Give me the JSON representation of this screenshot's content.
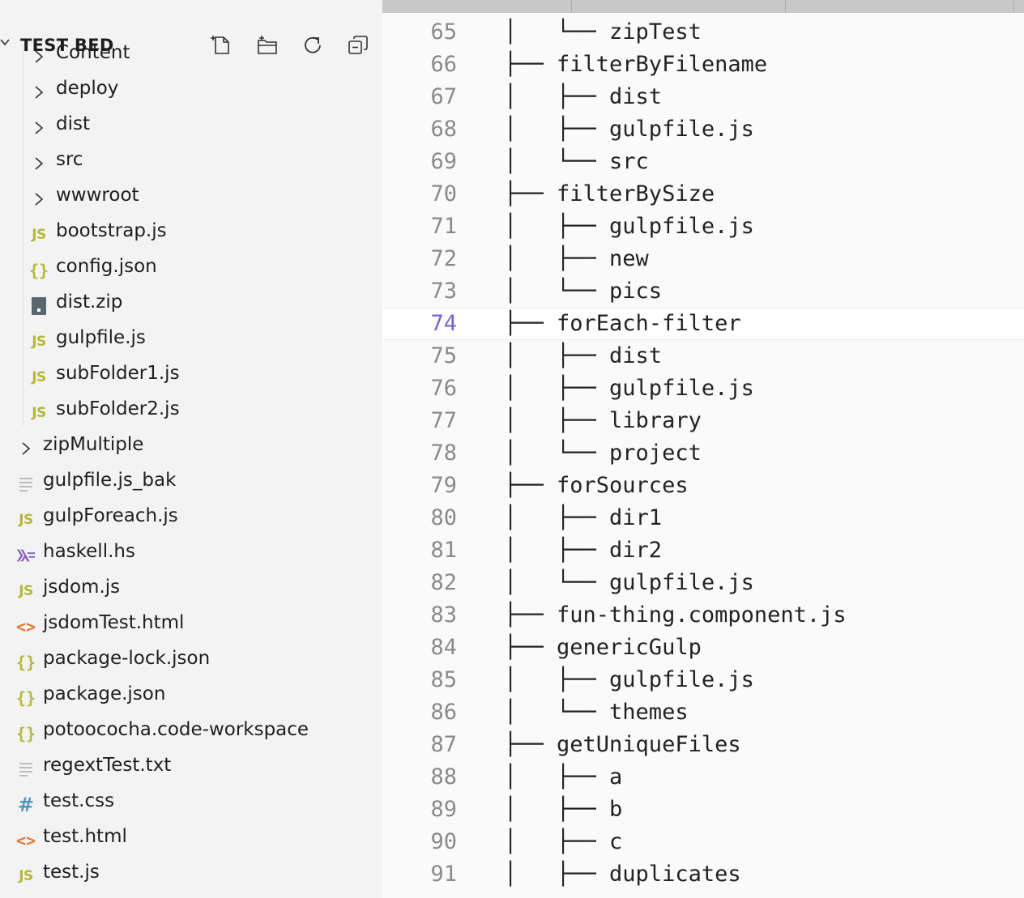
{
  "explorer": {
    "title": "TEST BED",
    "actions": [
      {
        "name": "new-file-icon"
      },
      {
        "name": "new-folder-icon"
      },
      {
        "name": "refresh-icon"
      },
      {
        "name": "collapse-all-icon"
      }
    ],
    "items": [
      {
        "label": "Content",
        "type": "folder",
        "depth": 2
      },
      {
        "label": "deploy",
        "type": "folder",
        "depth": 2
      },
      {
        "label": "dist",
        "type": "folder",
        "depth": 2
      },
      {
        "label": "src",
        "type": "folder",
        "depth": 2
      },
      {
        "label": "wwwroot",
        "type": "folder",
        "depth": 2
      },
      {
        "label": "bootstrap.js",
        "type": "js",
        "depth": 2
      },
      {
        "label": "config.json",
        "type": "json",
        "depth": 2
      },
      {
        "label": "dist.zip",
        "type": "zip",
        "depth": 2
      },
      {
        "label": "gulpfile.js",
        "type": "js",
        "depth": 2
      },
      {
        "label": "subFolder1.js",
        "type": "js",
        "depth": 2
      },
      {
        "label": "subFolder2.js",
        "type": "js",
        "depth": 2
      },
      {
        "label": "zipMultiple",
        "type": "folder",
        "depth": 1
      },
      {
        "label": "gulpfile.js_bak",
        "type": "text",
        "depth": 1
      },
      {
        "label": "gulpForeach.js",
        "type": "js",
        "depth": 1
      },
      {
        "label": "haskell.hs",
        "type": "haskell",
        "depth": 1
      },
      {
        "label": "jsdom.js",
        "type": "js",
        "depth": 1
      },
      {
        "label": "jsdomTest.html",
        "type": "html",
        "depth": 1
      },
      {
        "label": "package-lock.json",
        "type": "json",
        "depth": 1
      },
      {
        "label": "package.json",
        "type": "json",
        "depth": 1
      },
      {
        "label": "potoococha.code-workspace",
        "type": "json",
        "depth": 1
      },
      {
        "label": "regextTest.txt",
        "type": "text",
        "depth": 1
      },
      {
        "label": "test.css",
        "type": "css",
        "depth": 1
      },
      {
        "label": "test.html",
        "type": "html",
        "depth": 1
      },
      {
        "label": "test.js",
        "type": "js",
        "depth": 1
      }
    ],
    "icon_glyphs": {
      "js": "JS",
      "json": "{}",
      "html": "<>",
      "css": "#"
    }
  },
  "editor": {
    "active_line": 74,
    "lines": [
      {
        "n": "65",
        "text": "│   └── zipTest"
      },
      {
        "n": "66",
        "text": "├── filterByFilename"
      },
      {
        "n": "67",
        "text": "│   ├── dist"
      },
      {
        "n": "68",
        "text": "│   ├── gulpfile.js"
      },
      {
        "n": "69",
        "text": "│   └── src"
      },
      {
        "n": "70",
        "text": "├── filterBySize"
      },
      {
        "n": "71",
        "text": "│   ├── gulpfile.js"
      },
      {
        "n": "72",
        "text": "│   ├── new"
      },
      {
        "n": "73",
        "text": "│   └── pics"
      },
      {
        "n": "74",
        "text": "├── forEach-filter"
      },
      {
        "n": "75",
        "text": "│   ├── dist"
      },
      {
        "n": "76",
        "text": "│   ├── gulpfile.js"
      },
      {
        "n": "77",
        "text": "│   ├── library"
      },
      {
        "n": "78",
        "text": "│   └── project"
      },
      {
        "n": "79",
        "text": "├── forSources"
      },
      {
        "n": "80",
        "text": "│   ├── dir1"
      },
      {
        "n": "81",
        "text": "│   ├── dir2"
      },
      {
        "n": "82",
        "text": "│   └── gulpfile.js"
      },
      {
        "n": "83",
        "text": "├── fun-thing.component.js"
      },
      {
        "n": "84",
        "text": "├── genericGulp"
      },
      {
        "n": "85",
        "text": "│   ├── gulpfile.js"
      },
      {
        "n": "86",
        "text": "│   └── themes"
      },
      {
        "n": "87",
        "text": "├── getUniqueFiles"
      },
      {
        "n": "88",
        "text": "│   ├── a"
      },
      {
        "n": "89",
        "text": "│   ├── b"
      },
      {
        "n": "90",
        "text": "│   ├── c"
      },
      {
        "n": "91",
        "text": "│   ├── duplicates"
      }
    ]
  },
  "colors": {
    "js": "#b7b73b",
    "json": "#b7b73b",
    "html": "#e37933",
    "css": "#519aba",
    "haskell": "#a074c4",
    "active_line_number": "#7b5fd0"
  }
}
